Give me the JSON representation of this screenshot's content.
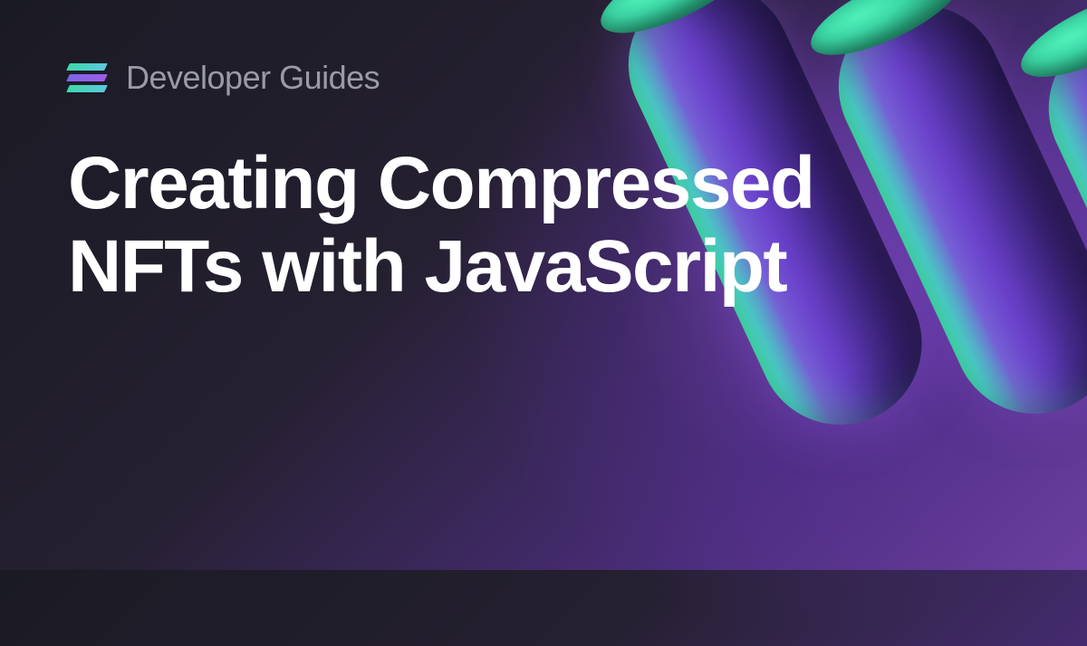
{
  "header": {
    "subtitle": "Developer Guides"
  },
  "main": {
    "title": "Creating Compressed NFTs with JavaScript"
  }
}
